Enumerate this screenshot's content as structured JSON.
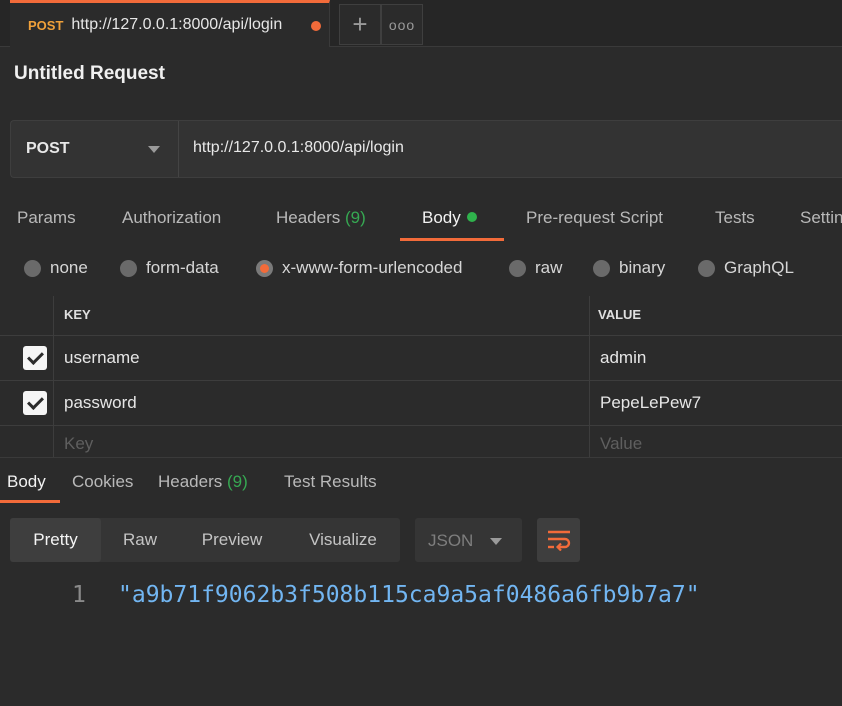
{
  "request_tab": {
    "method": "POST",
    "url": "http://127.0.0.1:8000/api/login",
    "plus_glyph": "+",
    "more_glyph": "ooo"
  },
  "request": {
    "title": "Untitled Request",
    "method": "POST",
    "url": "http://127.0.0.1:8000/api/login"
  },
  "request_tabs": {
    "params": "Params",
    "authorization": "Authorization",
    "headers": "Headers",
    "headers_count": "(9)",
    "body": "Body",
    "prerequest": "Pre-request Script",
    "tests": "Tests",
    "settings": "Settin"
  },
  "body_types": {
    "none": "none",
    "form_data": "form-data",
    "urlencoded": "x-www-form-urlencoded",
    "raw": "raw",
    "binary": "binary",
    "graphql": "GraphQL",
    "selected": "x-www-form-urlencoded"
  },
  "params_table": {
    "key_header": "KEY",
    "value_header": "VALUE",
    "rows": [
      {
        "key": "username",
        "value": "admin",
        "checked": true
      },
      {
        "key": "password",
        "value": "PepeLePew7",
        "checked": true
      }
    ],
    "placeholder_key": "Key",
    "placeholder_value": "Value"
  },
  "response_tabs": {
    "body": "Body",
    "cookies": "Cookies",
    "headers": "Headers",
    "headers_count": "(9)",
    "test_results": "Test Results"
  },
  "response_view": {
    "pretty": "Pretty",
    "raw": "Raw",
    "preview": "Preview",
    "visualize": "Visualize",
    "format": "JSON"
  },
  "response_body": {
    "line_number": "1",
    "content": "\"a9b71f9062b3f508b115ca9a5af0486a6fb9b7a7\""
  },
  "colors": {
    "accent": "#f26b3a",
    "method_post": "#f0a13a",
    "count_green": "#36a852",
    "string_blue": "#72b6f2"
  }
}
